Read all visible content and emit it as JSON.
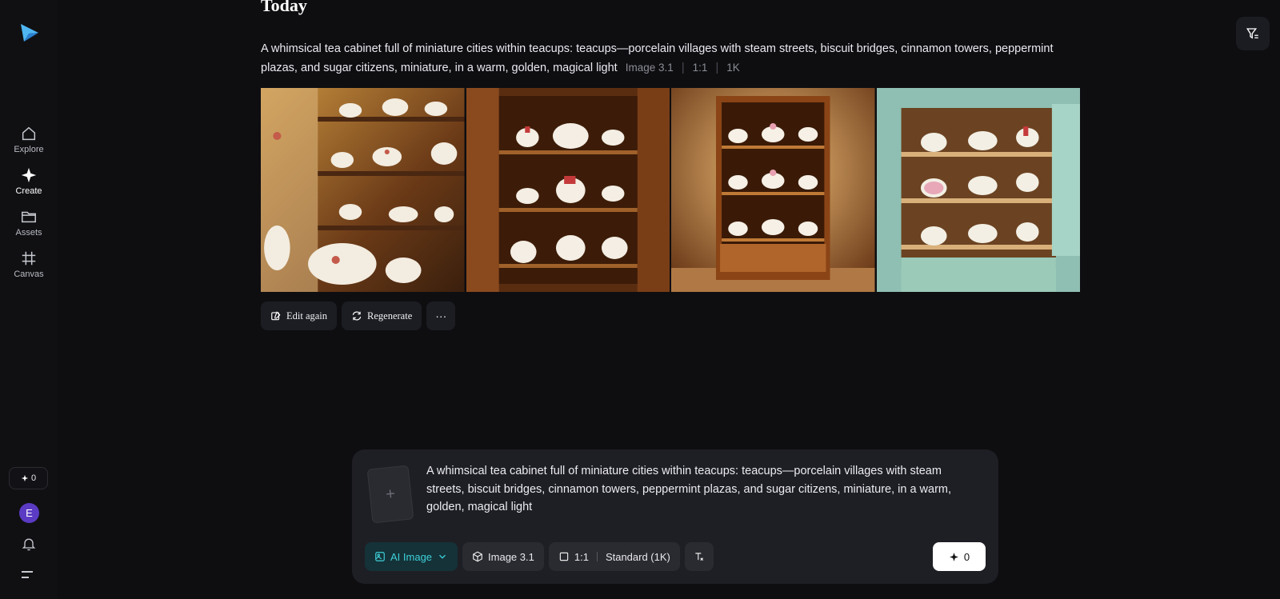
{
  "sidebar": {
    "items": [
      {
        "label": "Explore",
        "icon": "home-icon"
      },
      {
        "label": "Create",
        "icon": "sparkle-icon"
      },
      {
        "label": "Assets",
        "icon": "folder-icon"
      },
      {
        "label": "Canvas",
        "icon": "grid-canvas-icon"
      }
    ],
    "credits": "0",
    "avatar_initial": "E"
  },
  "main": {
    "section_title": "Today",
    "prompt": "A whimsical tea cabinet full of miniature cities within teacups: teacups—porcelain villages with steam streets, biscuit bridges, cinnamon towers, peppermint plazas, and sugar citizens, miniature, in a warm, golden, magical light",
    "meta": {
      "model": "Image 3.1",
      "ratio": "1:1",
      "resolution": "1K"
    },
    "images": [
      {
        "name": "cabinet-image-1"
      },
      {
        "name": "cabinet-image-2"
      },
      {
        "name": "cabinet-image-3"
      },
      {
        "name": "cabinet-image-4"
      }
    ],
    "actions": {
      "edit_label": "Edit again",
      "regenerate_label": "Regenerate",
      "more_label": "···"
    }
  },
  "composer": {
    "upload_symbol": "+",
    "text": "A whimsical tea cabinet full of miniature cities within teacups: teacups—porcelain villages with steam streets, biscuit bridges, cinnamon towers, peppermint plazas, and sugar citizens, miniature, in a warm, golden, magical light",
    "mode_label": "AI Image",
    "model_label": "Image 3.1",
    "ratio_label": "1:1",
    "quality_label": "Standard (1K)",
    "generate_cost": "0"
  },
  "colors": {
    "accent": "#3fd0d8",
    "background": "#0e0e11",
    "avatar": "#5b3bc4"
  }
}
